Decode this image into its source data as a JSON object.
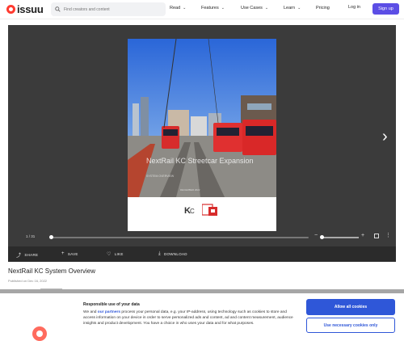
{
  "brand": {
    "name": "issuu"
  },
  "search": {
    "placeholder": "Find creators and content"
  },
  "nav": {
    "items": [
      {
        "label": "Read"
      },
      {
        "label": "Features"
      },
      {
        "label": "Use Cases"
      },
      {
        "label": "Learn"
      },
      {
        "label": "Pricing"
      }
    ],
    "login_label": "Log in",
    "signup_label": "Sign up"
  },
  "reader": {
    "cover_title": "NextRail KC Streetcar Expansion",
    "cover_subtitle": "SYSTEM OVERVIEW",
    "cover_date": "DECEMBER 2022",
    "page_indicator": "1 / 31",
    "actions": {
      "share": "SHARE",
      "save": "SAVE",
      "like": "LIKE",
      "download": "DOWNLOAD"
    }
  },
  "document": {
    "title": "NextRail KC System Overview",
    "published": "Published on Dec 16, 2022"
  },
  "consent": {
    "title": "Responsible use of your data",
    "text_before": "We and ",
    "partners_link": "our partners",
    "text_after": " process your personal data, e.g. your IP-address, using technology such as cookies to store and access information on your device in order to serve personalized ads and content, ad and content measurement, audience insights and product development. You have a choice in who uses your data and for what purposes.",
    "allow_all": "Allow all cookies",
    "necessary_only": "Use necessary cookies only"
  },
  "colors": {
    "brand_red": "#ff3b30",
    "signup_purple": "#5c4ee5",
    "consent_blue": "#2f57d8",
    "reader_bg": "#3b3b3b"
  }
}
